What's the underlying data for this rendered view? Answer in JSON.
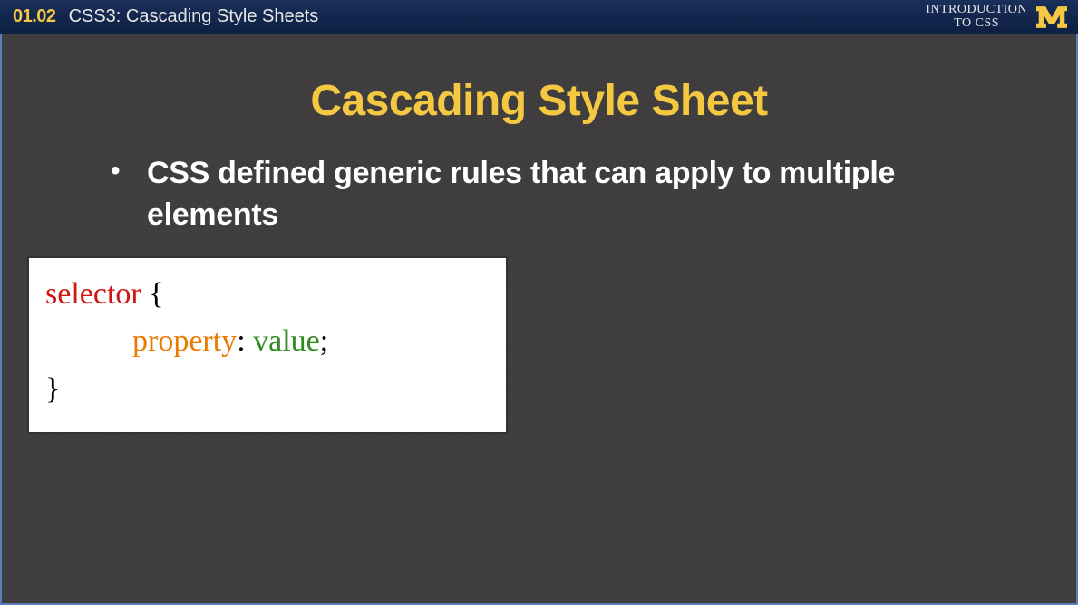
{
  "header": {
    "lesson_number": "01.02",
    "lesson_title": "CSS3: Cascading Style Sheets",
    "course_label_line1": "INTRODUCTION",
    "course_label_line2": "TO CSS"
  },
  "slide": {
    "title": "Cascading Style Sheet",
    "bullet": "CSS defined generic rules that can apply to multiple elements"
  },
  "code": {
    "selector": "selector",
    "open_brace": " {",
    "property": "property",
    "colon": ": ",
    "value": "value",
    "semicolon": ";",
    "close_brace": "}"
  }
}
